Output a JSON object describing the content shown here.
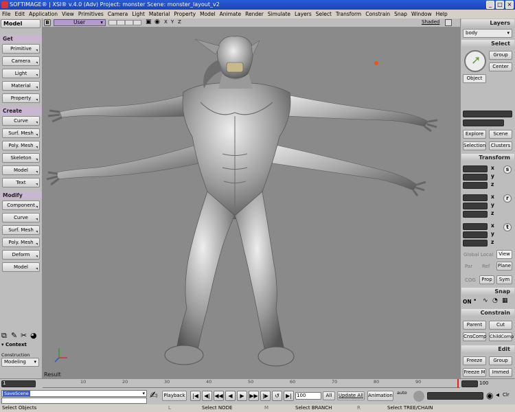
{
  "window": {
    "title": "SOFTIMAGE® | XSI® v.4.0 (Adv) Project: monster    Scene: monster_layout_v2"
  },
  "menu": [
    "File",
    "Edit",
    "Application",
    "View",
    "Primitives",
    "Camera",
    "Light",
    "Material",
    "Property",
    "Model",
    "Animate",
    "Render",
    "Simulate",
    "Layers",
    "Select",
    "Transform",
    "Constrain",
    "Snap",
    "Window",
    "Help"
  ],
  "left": {
    "module": "Model",
    "get_header": "Get",
    "get": [
      "Primitive",
      "Camera",
      "Light",
      "Material",
      "Property"
    ],
    "create_header": "Create",
    "create": [
      "Curve",
      "Surf. Mesh",
      "Poly. Mesh",
      "Skeleton",
      "Model",
      "Text"
    ],
    "modify_header": "Modify",
    "modify": [
      "Component",
      "Curve",
      "Surf. Mesh",
      "Poly. Mesh",
      "Deform",
      "Model"
    ],
    "context_label": "Context",
    "construction_mode_label": "Construction Mode",
    "construction_mode": "Modeling"
  },
  "viewport": {
    "camera": "User",
    "shading": "Shaded",
    "result_label": "Result",
    "axes": [
      "X",
      "Y",
      "Z"
    ]
  },
  "right": {
    "layers_header": "Layers",
    "layer_value": "body",
    "select_header": "Select",
    "group": "Group",
    "center": "Center",
    "object": "Object",
    "explore": "Explore",
    "scene": "Scene",
    "selection": "Selection",
    "clusters": "Clusters",
    "transform_header": "Transform",
    "xyz": [
      "x",
      "y",
      "z"
    ],
    "srt": [
      "s",
      "r",
      "t"
    ],
    "global": "Global",
    "local": "Local",
    "view": "View",
    "par": "Par",
    "ref": "Ref",
    "plane": "Plane",
    "cog": "COG",
    "prop": "Prop",
    "sym": "Sym",
    "snap_header": "Snap",
    "on": "ON",
    "constrain_header": "Constrain",
    "parent": "Parent",
    "cut": "Cut",
    "cnscomp": "CnsComp",
    "childcomp": "ChildComp",
    "edit_header": "Edit",
    "freeze": "Freeze",
    "edit_group": "Group",
    "freezem": "Freeze M",
    "immed": "Immed"
  },
  "timeline": {
    "start": "1",
    "end": "100",
    "ticks": [
      "10",
      "20",
      "30",
      "40",
      "50",
      "60",
      "70",
      "80",
      "90"
    ]
  },
  "bottom": {
    "command": "SaveScene",
    "playback": "Playback",
    "frame": "100",
    "all": "All",
    "update_all": "Update All",
    "animation": "Animation",
    "auto": "auto",
    "clr": "Clr"
  },
  "status": {
    "left": "Select Objects",
    "l": "L",
    "l_text": "Select NODE",
    "m": "M",
    "m_text": "Select BRANCH",
    "r": "R",
    "r_text": "Select TREE/CHAIN"
  },
  "colors": {
    "title": "#2a5bd7",
    "section": "#c9b7d2",
    "viewport": "#8a8a8a"
  }
}
